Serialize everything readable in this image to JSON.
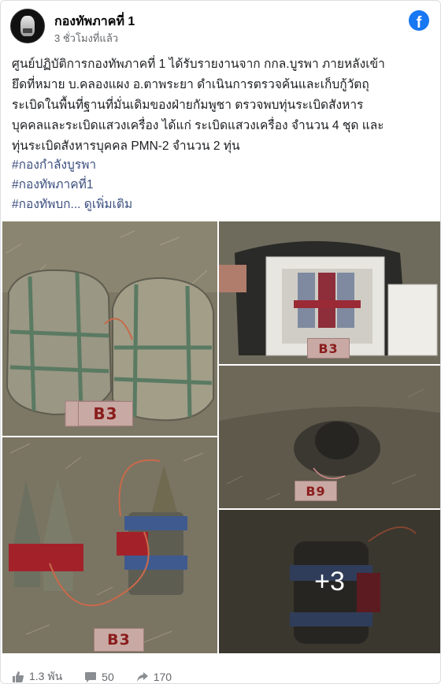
{
  "header": {
    "page_name": "กองทัพภาคที่ 1",
    "timestamp": "3 ชั่วโมงที่แล้ว",
    "platform_icon": "facebook-icon",
    "brand_color": "#1877f2"
  },
  "post": {
    "text_lines": [
      "ศูนย์ปฏิบัติการกองทัพภาคที่ 1 ได้รับรายงานจาก กกล.บูรพา ภายหลังเข้า",
      "ยึดที่หมาย บ.คลองแผง อ.ตาพระยา ดำเนินการตรวจค้นและเก็บกู้วัตถุ",
      "ระเบิดในพื้นที่ฐานที่มั่นเดิมของฝ่ายกัมพูชา ตรวจพบทุ่นระเบิดสังหาร",
      "บุคคลและระเบิดแสวงเครื่อง ได้แก่ ระเบิดแสวงเครื่อง จำนวน 4 ชุด และ",
      "ทุ่นระเบิดสังหารบุคคล PMN-2 จำนวน 2 ทุ่น"
    ],
    "hashtags": [
      "#กองกำลังบูรพา",
      "#กองทัพภาคที่1"
    ],
    "truncated_tag": "#กองทัพบก...",
    "see_more": "ดูเพิ่มเติม",
    "link_color": "#3b4e7e"
  },
  "photos": [
    {
      "label": "B3"
    },
    {
      "label": "B3"
    },
    {
      "label": "B9"
    },
    {
      "label": "B3"
    },
    {
      "overlay": "+3"
    }
  ],
  "footer": {
    "reactions": "1.3 พัน",
    "comments": "50",
    "shares": "170"
  }
}
